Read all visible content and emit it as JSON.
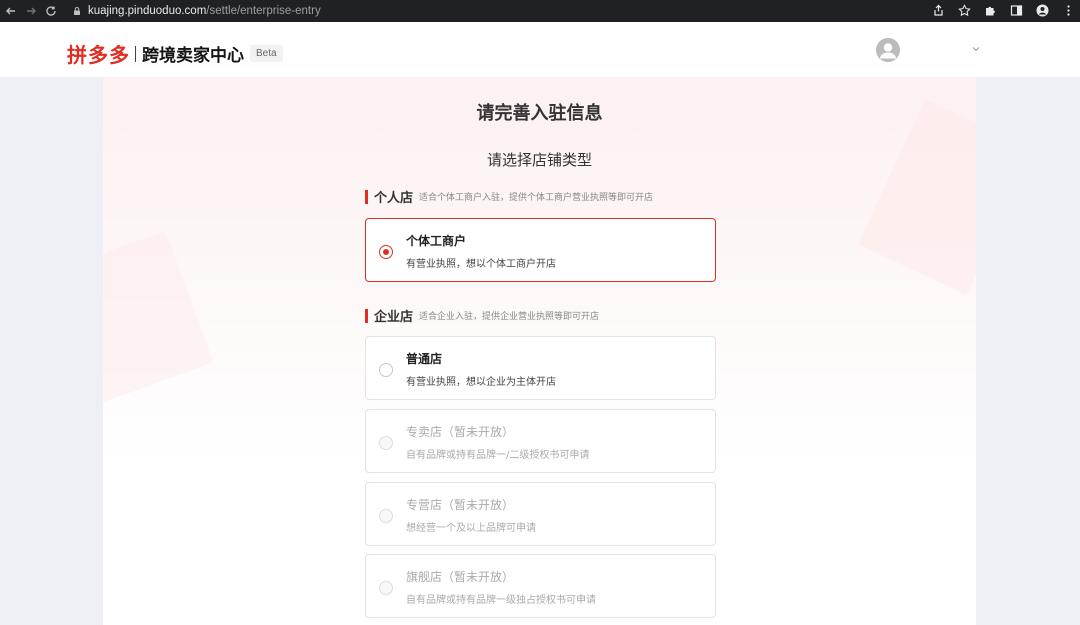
{
  "browser": {
    "url_host": "kuajing.pinduoduo.com",
    "url_path": "/settle/enterprise-entry"
  },
  "header": {
    "brand": "拼多多",
    "title": "跨境卖家中心",
    "badge": "Beta"
  },
  "main": {
    "title": "请完善入驻信息",
    "subtitle": "请选择店铺类型",
    "sections": [
      {
        "label": "个人店",
        "description": "适合个体工商户入驻，提供个体工商户营业执照等即可开店",
        "options": [
          {
            "title": "个体工商户",
            "description": "有营业执照，想以个体工商户开店",
            "state": "selected"
          }
        ]
      },
      {
        "label": "企业店",
        "description": "适合企业入驻，提供企业营业执照等即可开店",
        "options": [
          {
            "title": "普通店",
            "description": "有营业执照，想以企业为主体开店",
            "state": "enabled"
          },
          {
            "title": "专卖店（暂未开放）",
            "description": "自有品牌或持有品牌一/二级授权书可申请",
            "state": "disabled"
          },
          {
            "title": "专营店（暂未开放）",
            "description": "想经营一个及以上品牌可申请",
            "state": "disabled"
          },
          {
            "title": "旗舰店（暂未开放）",
            "description": "自有品牌或持有品牌一级独占授权书可申请",
            "state": "disabled"
          }
        ]
      }
    ]
  },
  "colors": {
    "accent": "#e02e24",
    "chrome": "#202124"
  },
  "icons": {
    "back": "arrow-left-icon",
    "forward": "arrow-right-icon",
    "reload": "reload-icon",
    "lock": "lock-icon",
    "share": "share-icon",
    "star": "star-icon",
    "extensions": "puzzle-icon",
    "sidebar": "sidebar-icon",
    "profile": "profile-icon",
    "menu": "kebab-menu-icon",
    "user": "user-avatar-icon",
    "dropdown": "chevron-down-icon"
  }
}
